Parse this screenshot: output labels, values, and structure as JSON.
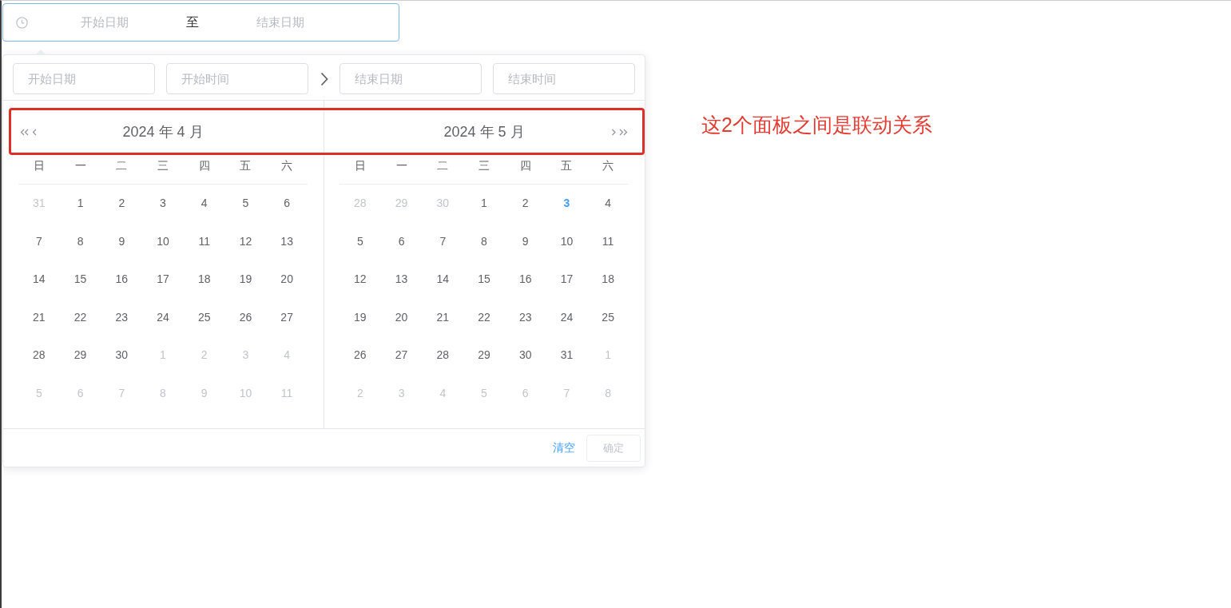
{
  "range_input": {
    "focused": true,
    "start_placeholder": "开始日期",
    "separator": "至",
    "end_placeholder": "结束日期"
  },
  "picker": {
    "time_header": {
      "start_date": {
        "placeholder": "开始日期"
      },
      "start_time": {
        "placeholder": "开始时间"
      },
      "end_date": {
        "placeholder": "结束日期"
      },
      "end_time": {
        "placeholder": "结束时间"
      }
    },
    "panels": [
      {
        "title": "2024 年 4 月",
        "weekdays": [
          "日",
          "一",
          "二",
          "三",
          "四",
          "五",
          "六"
        ],
        "weeks": [
          [
            {
              "text": "31",
              "other_month": true,
              "today": false
            },
            {
              "text": "1",
              "other_month": false,
              "today": false
            },
            {
              "text": "2",
              "other_month": false,
              "today": false
            },
            {
              "text": "3",
              "other_month": false,
              "today": false
            },
            {
              "text": "4",
              "other_month": false,
              "today": false
            },
            {
              "text": "5",
              "other_month": false,
              "today": false
            },
            {
              "text": "6",
              "other_month": false,
              "today": false
            }
          ],
          [
            {
              "text": "7",
              "other_month": false,
              "today": false
            },
            {
              "text": "8",
              "other_month": false,
              "today": false
            },
            {
              "text": "9",
              "other_month": false,
              "today": false
            },
            {
              "text": "10",
              "other_month": false,
              "today": false
            },
            {
              "text": "11",
              "other_month": false,
              "today": false
            },
            {
              "text": "12",
              "other_month": false,
              "today": false
            },
            {
              "text": "13",
              "other_month": false,
              "today": false
            }
          ],
          [
            {
              "text": "14",
              "other_month": false,
              "today": false
            },
            {
              "text": "15",
              "other_month": false,
              "today": false
            },
            {
              "text": "16",
              "other_month": false,
              "today": false
            },
            {
              "text": "17",
              "other_month": false,
              "today": false
            },
            {
              "text": "18",
              "other_month": false,
              "today": false
            },
            {
              "text": "19",
              "other_month": false,
              "today": false
            },
            {
              "text": "20",
              "other_month": false,
              "today": false
            }
          ],
          [
            {
              "text": "21",
              "other_month": false,
              "today": false
            },
            {
              "text": "22",
              "other_month": false,
              "today": false
            },
            {
              "text": "23",
              "other_month": false,
              "today": false
            },
            {
              "text": "24",
              "other_month": false,
              "today": false
            },
            {
              "text": "25",
              "other_month": false,
              "today": false
            },
            {
              "text": "26",
              "other_month": false,
              "today": false
            },
            {
              "text": "27",
              "other_month": false,
              "today": false
            }
          ],
          [
            {
              "text": "28",
              "other_month": false,
              "today": false
            },
            {
              "text": "29",
              "other_month": false,
              "today": false
            },
            {
              "text": "30",
              "other_month": false,
              "today": false
            },
            {
              "text": "1",
              "other_month": true,
              "today": false
            },
            {
              "text": "2",
              "other_month": true,
              "today": false
            },
            {
              "text": "3",
              "other_month": true,
              "today": false
            },
            {
              "text": "4",
              "other_month": true,
              "today": false
            }
          ],
          [
            {
              "text": "5",
              "other_month": true,
              "today": false
            },
            {
              "text": "6",
              "other_month": true,
              "today": false
            },
            {
              "text": "7",
              "other_month": true,
              "today": false
            },
            {
              "text": "8",
              "other_month": true,
              "today": false
            },
            {
              "text": "9",
              "other_month": true,
              "today": false
            },
            {
              "text": "10",
              "other_month": true,
              "today": false
            },
            {
              "text": "11",
              "other_month": true,
              "today": false
            }
          ]
        ]
      },
      {
        "title": "2024 年 5 月",
        "weekdays": [
          "日",
          "一",
          "二",
          "三",
          "四",
          "五",
          "六"
        ],
        "weeks": [
          [
            {
              "text": "28",
              "other_month": true,
              "today": false
            },
            {
              "text": "29",
              "other_month": true,
              "today": false
            },
            {
              "text": "30",
              "other_month": true,
              "today": false
            },
            {
              "text": "1",
              "other_month": false,
              "today": false
            },
            {
              "text": "2",
              "other_month": false,
              "today": false
            },
            {
              "text": "3",
              "other_month": false,
              "today": true
            },
            {
              "text": "4",
              "other_month": false,
              "today": false
            }
          ],
          [
            {
              "text": "5",
              "other_month": false,
              "today": false
            },
            {
              "text": "6",
              "other_month": false,
              "today": false
            },
            {
              "text": "7",
              "other_month": false,
              "today": false
            },
            {
              "text": "8",
              "other_month": false,
              "today": false
            },
            {
              "text": "9",
              "other_month": false,
              "today": false
            },
            {
              "text": "10",
              "other_month": false,
              "today": false
            },
            {
              "text": "11",
              "other_month": false,
              "today": false
            }
          ],
          [
            {
              "text": "12",
              "other_month": false,
              "today": false
            },
            {
              "text": "13",
              "other_month": false,
              "today": false
            },
            {
              "text": "14",
              "other_month": false,
              "today": false
            },
            {
              "text": "15",
              "other_month": false,
              "today": false
            },
            {
              "text": "16",
              "other_month": false,
              "today": false
            },
            {
              "text": "17",
              "other_month": false,
              "today": false
            },
            {
              "text": "18",
              "other_month": false,
              "today": false
            }
          ],
          [
            {
              "text": "19",
              "other_month": false,
              "today": false
            },
            {
              "text": "20",
              "other_month": false,
              "today": false
            },
            {
              "text": "21",
              "other_month": false,
              "today": false
            },
            {
              "text": "22",
              "other_month": false,
              "today": false
            },
            {
              "text": "23",
              "other_month": false,
              "today": false
            },
            {
              "text": "24",
              "other_month": false,
              "today": false
            },
            {
              "text": "25",
              "other_month": false,
              "today": false
            }
          ],
          [
            {
              "text": "26",
              "other_month": false,
              "today": false
            },
            {
              "text": "27",
              "other_month": false,
              "today": false
            },
            {
              "text": "28",
              "other_month": false,
              "today": false
            },
            {
              "text": "29",
              "other_month": false,
              "today": false
            },
            {
              "text": "30",
              "other_month": false,
              "today": false
            },
            {
              "text": "31",
              "other_month": false,
              "today": false
            },
            {
              "text": "1",
              "other_month": true,
              "today": false
            }
          ],
          [
            {
              "text": "2",
              "other_month": true,
              "today": false
            },
            {
              "text": "3",
              "other_month": true,
              "today": false
            },
            {
              "text": "4",
              "other_month": true,
              "today": false
            },
            {
              "text": "5",
              "other_month": true,
              "today": false
            },
            {
              "text": "6",
              "other_month": true,
              "today": false
            },
            {
              "text": "7",
              "other_month": true,
              "today": false
            },
            {
              "text": "8",
              "other_month": true,
              "today": false
            }
          ]
        ]
      }
    ],
    "footer": {
      "clear_link": "清空",
      "confirm_button": {
        "label": "确定",
        "disabled": true
      }
    }
  },
  "annotation": {
    "text": "这2个面板之间是联动关系"
  }
}
